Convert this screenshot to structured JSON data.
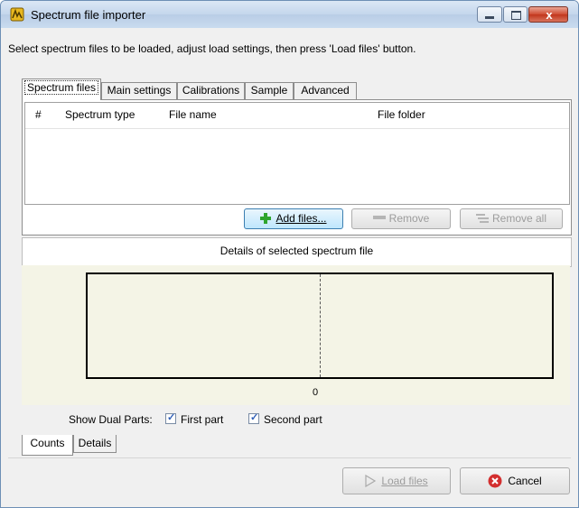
{
  "window": {
    "title": "Spectrum file importer",
    "close_glyph": "x",
    "instructions": "Select spectrum files to be loaded, adjust load settings, then press 'Load files' button."
  },
  "tabs": [
    {
      "label": "Spectrum files",
      "active": true
    },
    {
      "label": "Main settings",
      "active": false
    },
    {
      "label": "Calibrations",
      "active": false
    },
    {
      "label": "Sample",
      "active": false
    },
    {
      "label": "Advanced",
      "active": false
    }
  ],
  "file_table": {
    "columns": [
      "#",
      "Spectrum type",
      "File name",
      "File folder"
    ],
    "rows": []
  },
  "file_actions": {
    "add_label": "Add files...",
    "remove_label": "Remove",
    "remove_all_label": "Remove all"
  },
  "details": {
    "title": "Details of selected spectrum file",
    "axis_zero_label": "0",
    "show_dual_label": "Show Dual Parts:",
    "first_part_label": "First part",
    "first_part_checked": true,
    "second_part_label": "Second part",
    "second_part_checked": true
  },
  "bottom_tabs": [
    {
      "label": "Counts",
      "active": true
    },
    {
      "label": "Details",
      "active": false
    }
  ],
  "footer": {
    "load_label": "Load files",
    "cancel_label": "Cancel"
  },
  "colors": {
    "plot_background": "#f4f4e6",
    "add_icon": "#2ea52e",
    "cancel_icon": "#d32f2f"
  }
}
